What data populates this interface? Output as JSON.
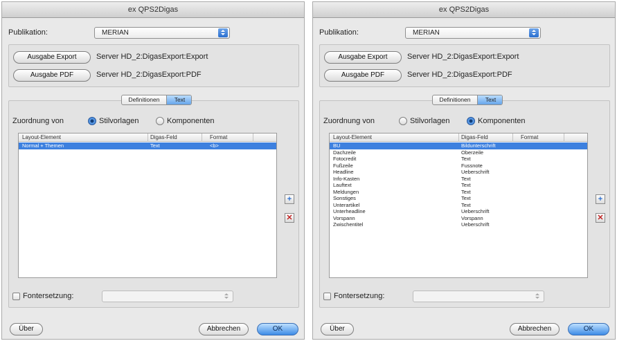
{
  "windows": [
    {
      "title": "ex QPS2Digas",
      "publikation": {
        "label": "Publikation:",
        "value": "MERIAN"
      },
      "export": {
        "button": "Ausgabe Export",
        "path": "Server HD_2:DigasExport:Export"
      },
      "pdf": {
        "button": "Ausgabe PDF",
        "path": "Server HD_2:DigasExport:PDF"
      },
      "tabs": [
        "Definitionen",
        "Text"
      ],
      "active_tab": "Text",
      "zuordnung": {
        "label": "Zuordnung von",
        "options": [
          "Stilvorlagen",
          "Komponenten"
        ],
        "selected": "Stilvorlagen"
      },
      "table": {
        "columns": [
          "Layout-Element",
          "Digas-Feld",
          "Format"
        ],
        "rows": [
          {
            "element": "Normal + Themen",
            "feld": "Text",
            "format": "<b>",
            "selected": true
          }
        ]
      },
      "fontersetzung": {
        "label": "Fontersetzung:",
        "checked": false,
        "value": ""
      },
      "buttons": {
        "about": "Über",
        "cancel": "Abbrechen",
        "ok": "OK"
      },
      "icons": {
        "add": "plus-icon",
        "remove": "x-icon"
      }
    },
    {
      "title": "ex QPS2Digas",
      "publikation": {
        "label": "Publikation:",
        "value": "MERIAN"
      },
      "export": {
        "button": "Ausgabe Export",
        "path": "Server HD_2:DigasExport:Export"
      },
      "pdf": {
        "button": "Ausgabe PDF",
        "path": "Server HD_2:DigasExport:PDF"
      },
      "tabs": [
        "Definitionen",
        "Text"
      ],
      "active_tab": "Text",
      "zuordnung": {
        "label": "Zuordnung von",
        "options": [
          "Stilvorlagen",
          "Komponenten"
        ],
        "selected": "Komponenten"
      },
      "table": {
        "columns": [
          "Layout-Element",
          "Digas-Feld",
          "Format"
        ],
        "rows": [
          {
            "element": "BU",
            "feld": "Bildunterschrift",
            "format": "",
            "selected": true
          },
          {
            "element": "Dachzeile",
            "feld": "Oberzeile",
            "format": ""
          },
          {
            "element": "Fotocredit",
            "feld": "Text",
            "format": ""
          },
          {
            "element": "Fußzeile",
            "feld": "Fussnote",
            "format": ""
          },
          {
            "element": "Headline",
            "feld": "Ueberschrift",
            "format": ""
          },
          {
            "element": "Info-Kasten",
            "feld": "Text",
            "format": ""
          },
          {
            "element": "Lauftext",
            "feld": "Text",
            "format": ""
          },
          {
            "element": "Meldungen",
            "feld": "Text",
            "format": ""
          },
          {
            "element": "Sonstiges",
            "feld": "Text",
            "format": ""
          },
          {
            "element": "Unterartikel",
            "feld": "Text",
            "format": ""
          },
          {
            "element": "Unterheadline",
            "feld": "Ueberschrift",
            "format": ""
          },
          {
            "element": "Vorspann",
            "feld": "Vorspann",
            "format": ""
          },
          {
            "element": "Zwischentitel",
            "feld": "Ueberschrift",
            "format": ""
          }
        ]
      },
      "fontersetzung": {
        "label": "Fontersetzung:",
        "checked": false,
        "value": ""
      },
      "buttons": {
        "about": "Über",
        "cancel": "Abbrechen",
        "ok": "OK"
      },
      "icons": {
        "add": "plus-icon",
        "remove": "x-icon"
      }
    }
  ]
}
